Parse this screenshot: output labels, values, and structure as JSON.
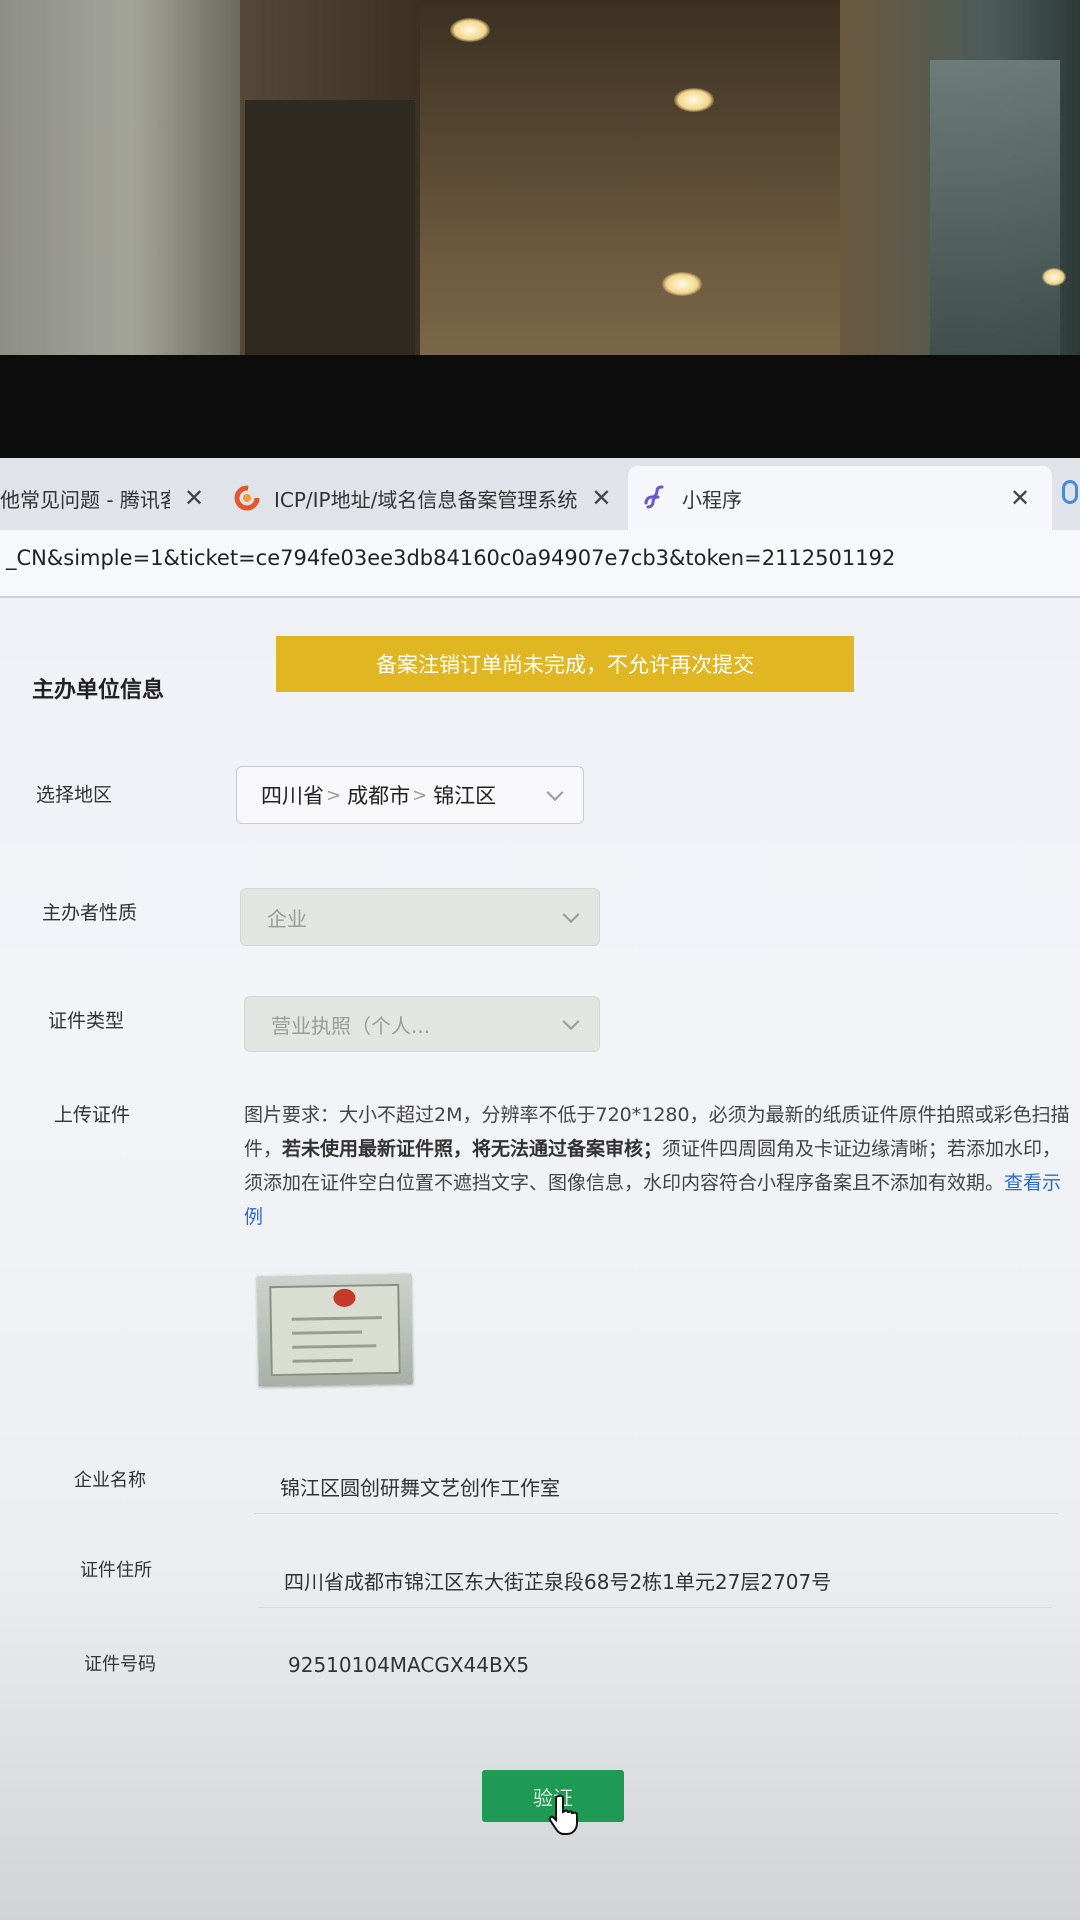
{
  "browser": {
    "tabs": [
      {
        "title": "他常见问题 - 腾讯客",
        "active": false
      },
      {
        "title": "ICP/IP地址/域名信息备案管理系统",
        "active": false
      },
      {
        "title": "小程序",
        "active": true
      }
    ],
    "url": "_CN&simple=1&ticket=ce794fe03ee3db84160c0a94907e7cb3&token=2112501192"
  },
  "page": {
    "alert": "备案注销订单尚未完成，不允许再次提交",
    "section_title": "主办单位信息",
    "region": {
      "label": "选择地区",
      "province": "四川省",
      "city": "成都市",
      "district": "锦江区"
    },
    "nature": {
      "label": "主办者性质",
      "value": "企业"
    },
    "cert_type": {
      "label": "证件类型",
      "value": "营业执照（个人..."
    },
    "upload": {
      "label": "上传证件",
      "req_1": "图片要求：大小不超过2M，分辨率不低于720*1280，必须为最新的纸质证件原件拍照或彩色扫描件，",
      "req_bold": "若未使用最新证件照，将无法通过备案审核；",
      "req_2": "须证件四周圆角及卡证边缘清晰；若添加水印，须添加在证件空白位置不遮挡文字、图像信息，水印内容符合小程序备案且不添加有效期。",
      "example_link": "查看示例"
    },
    "company_name": {
      "label": "企业名称",
      "value": "锦江区圆创研舞文艺创作工作室"
    },
    "address": {
      "label": "证件住所",
      "value": "四川省成都市锦江区东大街芷泉段68号2栋1单元27层2707号"
    },
    "cert_no": {
      "label": "证件号码",
      "value": "92510104MACGX44BX5"
    },
    "verify_button": "验证"
  },
  "colors": {
    "alert_bg": "#e0b622",
    "verify_bg": "#1e9a55",
    "link": "#2b6bd6"
  }
}
